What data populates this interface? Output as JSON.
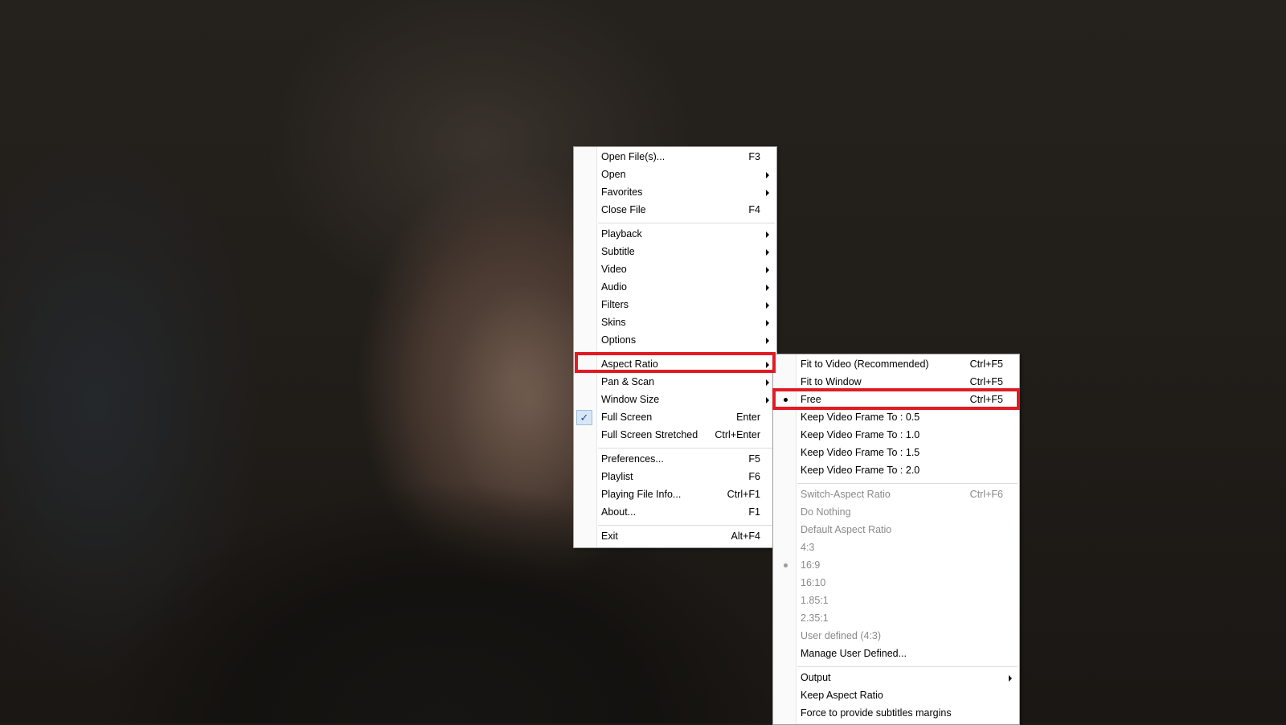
{
  "main_menu": {
    "items": [
      {
        "label": "Open File(s)...",
        "shortcut": "F3"
      },
      {
        "label": "Open",
        "shortcut": ""
      },
      {
        "label": "Favorites",
        "shortcut": ""
      },
      {
        "label": "Close File",
        "shortcut": "F4"
      },
      {
        "label": "Playback",
        "shortcut": ""
      },
      {
        "label": "Subtitle",
        "shortcut": ""
      },
      {
        "label": "Video",
        "shortcut": ""
      },
      {
        "label": "Audio",
        "shortcut": ""
      },
      {
        "label": "Filters",
        "shortcut": ""
      },
      {
        "label": "Skins",
        "shortcut": ""
      },
      {
        "label": "Options",
        "shortcut": ""
      },
      {
        "label": "Aspect Ratio",
        "shortcut": ""
      },
      {
        "label": "Pan & Scan",
        "shortcut": ""
      },
      {
        "label": "Window Size",
        "shortcut": ""
      },
      {
        "label": "Full Screen",
        "shortcut": "Enter",
        "checked": true
      },
      {
        "label": "Full Screen Stretched",
        "shortcut": "Ctrl+Enter"
      },
      {
        "label": "Preferences...",
        "shortcut": "F5"
      },
      {
        "label": "Playlist",
        "shortcut": "F6"
      },
      {
        "label": "Playing File Info...",
        "shortcut": "Ctrl+F1"
      },
      {
        "label": "About...",
        "shortcut": "F1"
      },
      {
        "label": "Exit",
        "shortcut": "Alt+F4"
      }
    ]
  },
  "aspect_submenu": {
    "items": [
      {
        "label": "Fit to Video (Recommended)",
        "shortcut": "Ctrl+F5"
      },
      {
        "label": "Fit to Window",
        "shortcut": "Ctrl+F5"
      },
      {
        "label": "Free",
        "shortcut": "Ctrl+F5",
        "selected": true
      },
      {
        "label": "Keep Video Frame To : 0.5",
        "shortcut": ""
      },
      {
        "label": "Keep Video Frame To : 1.0",
        "shortcut": ""
      },
      {
        "label": "Keep Video Frame To : 1.5",
        "shortcut": ""
      },
      {
        "label": "Keep Video Frame To : 2.0",
        "shortcut": ""
      },
      {
        "label": "Switch-Aspect Ratio",
        "shortcut": "Ctrl+F6",
        "disabled": true
      },
      {
        "label": "Do Nothing",
        "shortcut": "",
        "disabled": true
      },
      {
        "label": "Default Aspect Ratio",
        "shortcut": "",
        "disabled": true
      },
      {
        "label": "4:3",
        "shortcut": "",
        "disabled": true
      },
      {
        "label": "16:9",
        "shortcut": "",
        "disabled": true,
        "selected": true
      },
      {
        "label": "16:10",
        "shortcut": "",
        "disabled": true
      },
      {
        "label": "1.85:1",
        "shortcut": "",
        "disabled": true
      },
      {
        "label": "2.35:1",
        "shortcut": "",
        "disabled": true
      },
      {
        "label": "User defined (4:3)",
        "shortcut": "",
        "disabled": true
      },
      {
        "label": "Manage User Defined...",
        "shortcut": ""
      },
      {
        "label": "Output",
        "shortcut": ""
      },
      {
        "label": "Keep Aspect Ratio",
        "shortcut": ""
      },
      {
        "label": "Force to provide subtitles margins",
        "shortcut": ""
      }
    ]
  },
  "colors": {
    "highlight_border": "#e01b24",
    "menu_bg": "#ffffff",
    "disabled_text": "#8a8a8a",
    "check_bg": "#d8e6f5"
  },
  "icons": {
    "submenu_arrow": "chevron-right-icon",
    "check": "checkmark-icon",
    "radio": "bullet-icon"
  }
}
